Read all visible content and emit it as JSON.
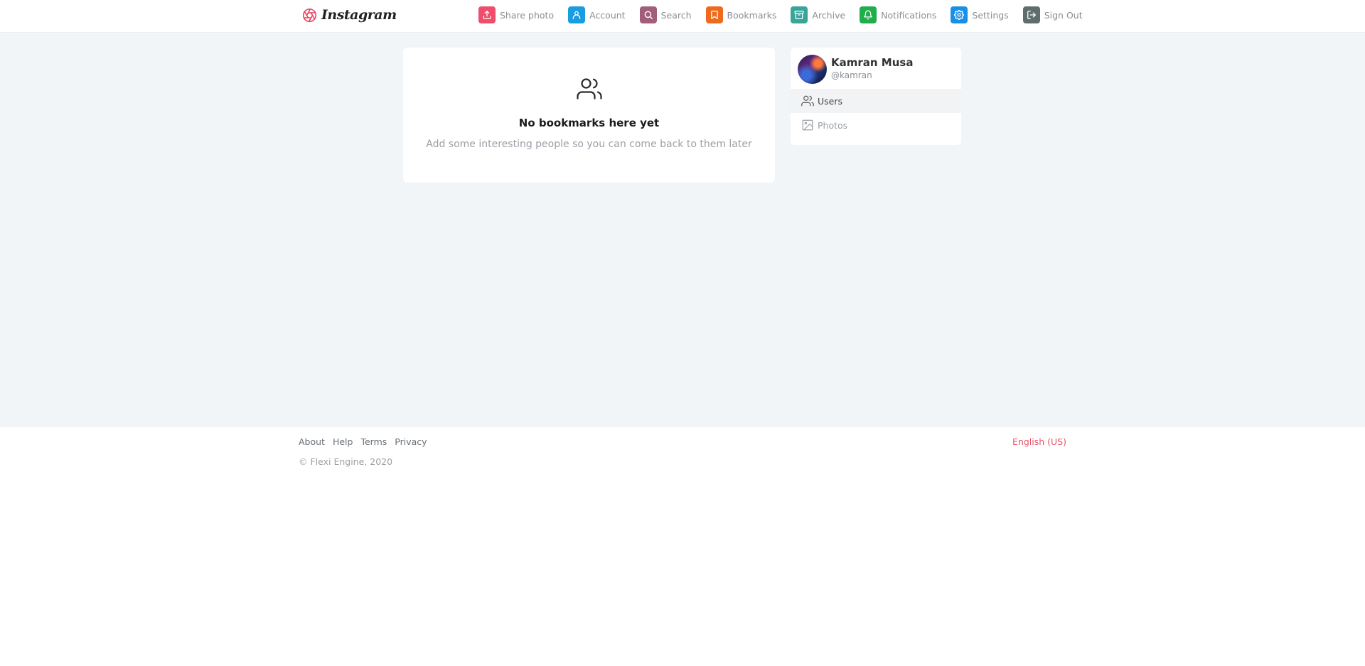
{
  "brand": {
    "name": "Instagram",
    "logo_icon": "aperture-icon",
    "color": "#e8405f"
  },
  "nav": {
    "items": [
      {
        "label": "Share photo",
        "icon": "upload-icon",
        "color": "#ef4d6b"
      },
      {
        "label": "Account",
        "icon": "user-icon",
        "color": "#1a9de0"
      },
      {
        "label": "Search",
        "icon": "search-icon",
        "color": "#a25d7b"
      },
      {
        "label": "Bookmarks",
        "icon": "bookmark-icon",
        "color": "#ee6b1e"
      },
      {
        "label": "Archive",
        "icon": "archive-icon",
        "color": "#3aa49a"
      },
      {
        "label": "Notifications",
        "icon": "bell-icon",
        "color": "#1fae4b"
      },
      {
        "label": "Settings",
        "icon": "gear-icon",
        "color": "#1890e8"
      },
      {
        "label": "Sign Out",
        "icon": "sign-out-icon",
        "color": "#5f6e6c"
      }
    ]
  },
  "empty_state": {
    "icon": "users-icon",
    "title": "No bookmarks here yet",
    "subtitle": "Add some interesting people so you can come back to them later"
  },
  "profile": {
    "name": "Kamran Musa",
    "handle": "@kamran",
    "menu": [
      {
        "label": "Users",
        "icon": "users-icon",
        "active": true
      },
      {
        "label": "Photos",
        "icon": "image-icon",
        "active": false
      }
    ]
  },
  "footer": {
    "links": [
      "About",
      "Help",
      "Terms",
      "Privacy"
    ],
    "copyright": "© Flexi Engine, 2020",
    "language": "English (US)"
  }
}
